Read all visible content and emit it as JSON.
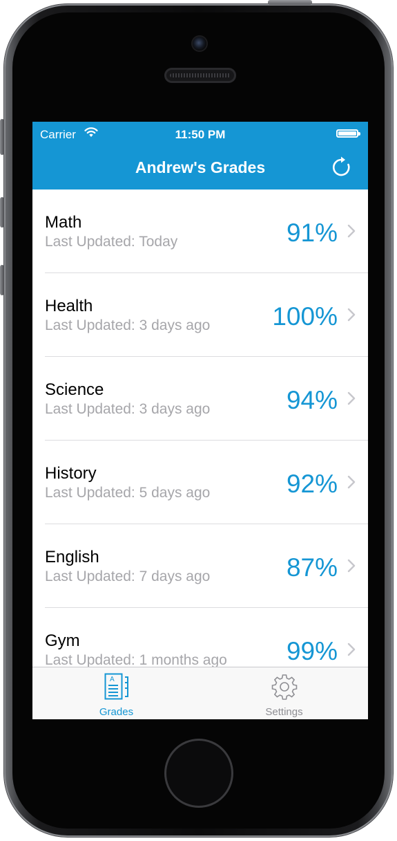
{
  "status_bar": {
    "carrier": "Carrier",
    "time": "11:50 PM"
  },
  "nav": {
    "title": "Andrew's Grades",
    "refresh_icon": "refresh-icon"
  },
  "grades": [
    {
      "subject": "Math",
      "updated": "Last Updated: Today",
      "grade": "91%"
    },
    {
      "subject": "Health",
      "updated": "Last Updated: 3 days ago",
      "grade": "100%"
    },
    {
      "subject": "Science",
      "updated": "Last Updated: 3 days ago",
      "grade": "94%"
    },
    {
      "subject": "History",
      "updated": "Last Updated: 5 days ago",
      "grade": "92%"
    },
    {
      "subject": "English",
      "updated": "Last Updated: 7 days ago",
      "grade": "87%"
    },
    {
      "subject": "Gym",
      "updated": "Last Updated: 1 months ago",
      "grade": "99%"
    }
  ],
  "tabbar": {
    "tabs": [
      {
        "label": "Grades",
        "icon": "grades-icon",
        "selected": true
      },
      {
        "label": "Settings",
        "icon": "gear-icon",
        "selected": false
      }
    ]
  },
  "colors": {
    "accent": "#1596d4",
    "tab_inactive": "#8e8e93",
    "subtitle": "#a6a6aa"
  }
}
